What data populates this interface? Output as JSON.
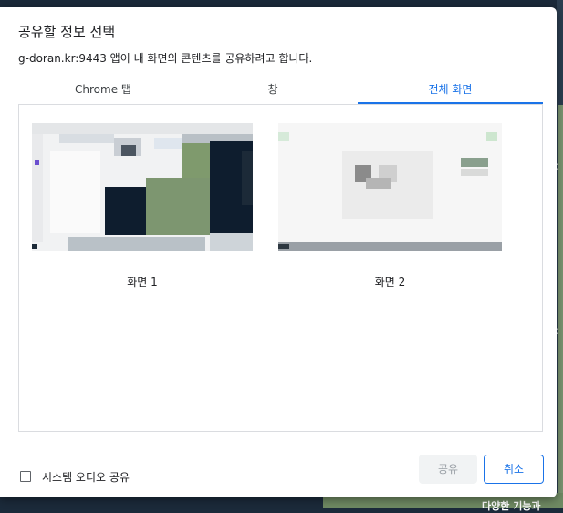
{
  "dialog": {
    "title": "공유할 정보 선택",
    "subtitle": "g-doran.kr:9443 앱이 내 화면의 콘텐츠를 공유하려고 합니다."
  },
  "tabs": [
    {
      "label": "Chrome 탭",
      "selected": false
    },
    {
      "label": "창",
      "selected": false
    },
    {
      "label": "전체 화면",
      "selected": true
    }
  ],
  "screens": [
    {
      "label": "화면 1"
    },
    {
      "label": "화면 2"
    }
  ],
  "audio": {
    "label": "시스템 오디오 공유",
    "checked": false
  },
  "buttons": {
    "share": "공유",
    "cancel": "취소"
  },
  "background": {
    "text": "다양한 기능과"
  },
  "colors": {
    "accent": "#1a73e8",
    "disabled_bg": "#f1f3f4",
    "disabled_text": "#9aa0a6"
  }
}
